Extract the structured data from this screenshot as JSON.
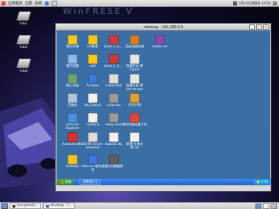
{
  "topbar": {
    "menu_apps": "应用程序",
    "menu_places": "位置",
    "menu_system": "系统",
    "clock": "1月12日星期日 10:54"
  },
  "logo_text": "WinFRESE V",
  "desktop_icons": [
    {
      "label": "hda1"
    },
    {
      "label": "hda5"
    },
    {
      "label": "hda6"
    }
  ],
  "window": {
    "title": "rdesktop - 192.168.0.5"
  },
  "remote_icons": [
    {
      "label": "我的文档",
      "icon": "folder-docs-icon",
      "color": "#f3c623"
    },
    {
      "label": "lsd程序",
      "icon": "folder-icon",
      "color": "#f3c623"
    },
    {
      "label": "j2sdk-1_4_...",
      "icon": "installer-icon",
      "color": "#c83c3c"
    },
    {
      "label": "花生壳服务器",
      "icon": "installer-icon",
      "color": "#d27a2d"
    },
    {
      "label": "sod02.rar",
      "icon": "archive-icon",
      "color": "#8a4ab0"
    },
    {
      "label": "我的电脑",
      "icon": "computer-icon",
      "color": "#8fb8e6"
    },
    {
      "label": "soft",
      "icon": "folder-icon",
      "color": "#f3c623"
    },
    {
      "label": "j2sdk-1_4_...",
      "icon": "installer-icon",
      "color": "#c83c3c"
    },
    {
      "label": "快捷方式 到 ing.txt",
      "icon": "shortcut-icon",
      "color": "#e6e6e6"
    },
    {
      "label": "网上邻居",
      "icon": "network-icon",
      "color": "#6fa36f"
    },
    {
      "label": "ACDSee",
      "icon": "acdsee-icon",
      "color": "#3c78d8"
    },
    {
      "label": "restart.bat",
      "icon": "batch-file-icon",
      "color": "#dcdcdc"
    },
    {
      "label": "快捷方式 到 Server.exe",
      "icon": "shortcut-icon",
      "color": "#e6e6e6"
    },
    {
      "label": "回收站",
      "icon": "recycle-bin-icon",
      "color": "#b0c4de"
    },
    {
      "label": "bb_Ling.pf",
      "icon": "file-icon",
      "color": "#f0f0f0"
    },
    {
      "label": "sviip.exe",
      "icon": "program-icon",
      "color": "#9a9a9a"
    },
    {
      "label": "任务计划",
      "icon": "scheduler-icon",
      "color": "#e0a030"
    },
    {
      "label": "Internet Explorer",
      "icon": "ie-icon",
      "color": "#4a90e2"
    },
    {
      "label": "config.in",
      "icon": "file-icon",
      "color": "#f0f0f0"
    },
    {
      "label": "show_map",
      "icon": "program-icon",
      "color": "#9a9a9a"
    },
    {
      "label": "我的电脑设置工具",
      "icon": "settings-icon",
      "color": "#d94a3a"
    },
    {
      "label": "Acrobat LING",
      "icon": "acrobat-icon",
      "color": "#d93030"
    },
    {
      "label": "HOTO Server Administ",
      "icon": "server-icon",
      "color": "#dcdcdc"
    },
    {
      "label": "kbps02.cfg",
      "icon": "file-icon",
      "color": "#f0f0f0"
    },
    {
      "label": "新建 文本文档.txt",
      "icon": "text-file-icon",
      "color": "#f0f0f0"
    },
    {
      "label": "AntiArpC",
      "icon": "folder-icon",
      "color": "#f3c623"
    },
    {
      "label": "Internet 星际战争",
      "icon": "game-icon",
      "color": "#3c78d8"
    },
    {
      "label": "备份的数据库",
      "icon": "database-icon",
      "color": "#606060"
    },
    {
      "label": "新建 文本文档 (2).txt",
      "icon": "text-file-icon",
      "color": "#f0f0f0"
    }
  ],
  "remote_taskbar": {
    "start_label": "开始",
    "task_label": "花生壳3.0",
    "tray_time": "0:36"
  },
  "bottom_taskbar": {
    "tasks": [
      {
        "label": "[Loesprhelp..."
      },
      {
        "label": "rdesktop - 1..."
      }
    ]
  }
}
